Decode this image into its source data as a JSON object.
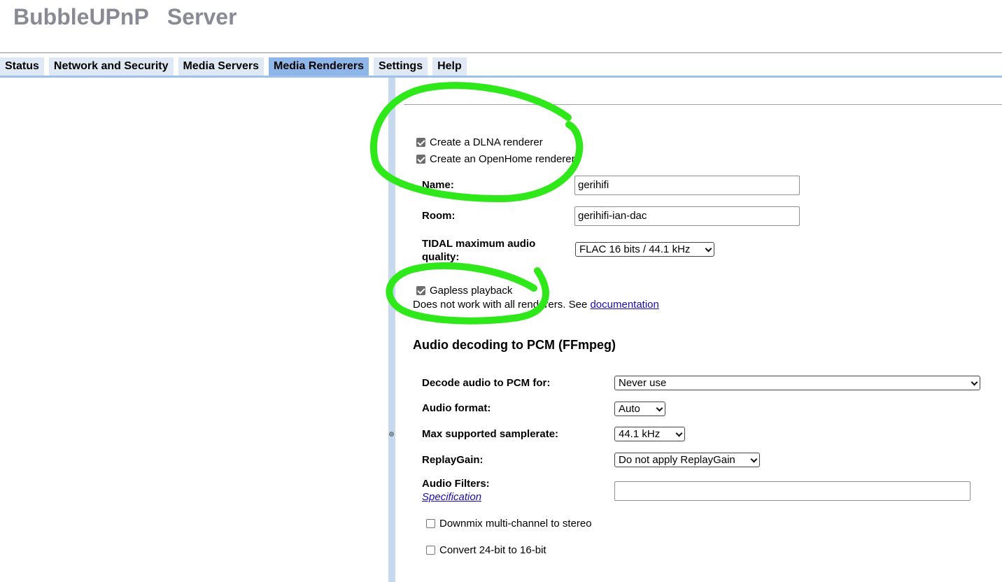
{
  "app": {
    "title": "BubbleUPnP   Server"
  },
  "tabs": [
    {
      "label": "Status",
      "active": false
    },
    {
      "label": "Network and Security",
      "active": false
    },
    {
      "label": "Media Servers",
      "active": false
    },
    {
      "label": "Media Renderers",
      "active": true
    },
    {
      "label": "Settings",
      "active": false
    },
    {
      "label": "Help",
      "active": false
    }
  ],
  "renderer": {
    "dlna_label": "Create a DLNA renderer",
    "dlna_checked": true,
    "openhome_label": "Create an OpenHome renderer",
    "openhome_checked": true,
    "name_label": "Name:",
    "name_value": "gerihifi",
    "room_label": "Room:",
    "room_value": "gerihifi-ian-dac",
    "tidal_label_line1": "TIDAL maximum audio",
    "tidal_label_line2": "quality:",
    "tidal_value": "FLAC 16 bits / 44.1 kHz",
    "gapless_label": "Gapless playback",
    "gapless_checked": true,
    "gapless_note": "Does not work with all renderers. See",
    "gapless_link": "documentation"
  },
  "ffmpeg": {
    "section_title": "Audio decoding to PCM (FFmpeg)",
    "decode_label": "Decode audio to PCM for:",
    "decode_value": "Never use",
    "format_label": "Audio format:",
    "format_value": "Auto",
    "samplerate_label": "Max supported samplerate:",
    "samplerate_value": "44.1 kHz",
    "replaygain_label": "ReplayGain:",
    "replaygain_value": "Do not apply ReplayGain",
    "filters_label": "Audio Filters:",
    "filters_link": "Specification",
    "filters_value": "",
    "downmix_label": "Downmix multi-channel to stereo",
    "downmix_checked": false,
    "convert_label": "Convert 24-bit to 16-bit",
    "convert_checked": false
  },
  "colors": {
    "annotation": "#2ee81a",
    "active_tab": "#8fb6e8",
    "tab": "#dfe9f5",
    "title": "#8a8a94"
  }
}
